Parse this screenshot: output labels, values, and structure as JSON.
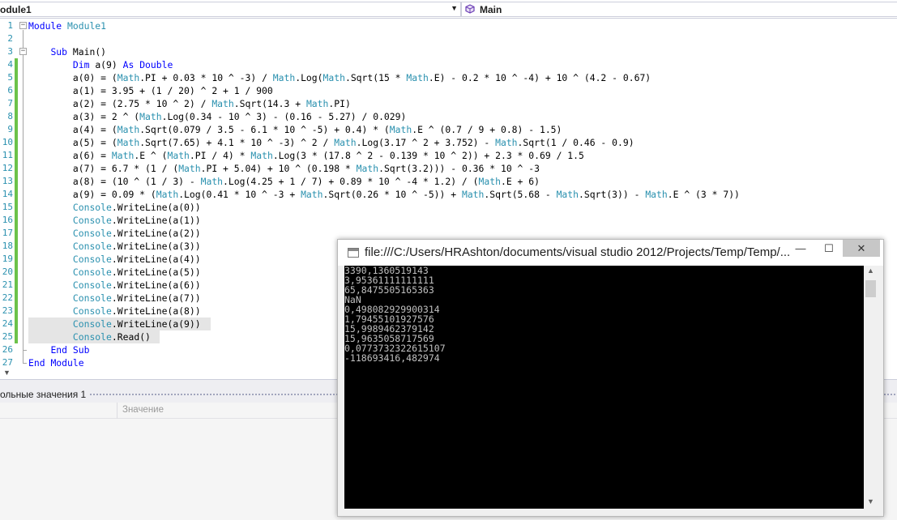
{
  "navbar": {
    "left_combo": "odule1",
    "right_combo": "Main"
  },
  "editor": {
    "line_numbers": [
      "1",
      "2",
      "3",
      "4",
      "5",
      "6",
      "7",
      "8",
      "9",
      "10",
      "11",
      "12",
      "13",
      "14",
      "15",
      "16",
      "17",
      "18",
      "19",
      "20",
      "21",
      "22",
      "23",
      "24",
      "25",
      "26",
      "27"
    ],
    "lines": [
      "Module Module1",
      "",
      "    Sub Main()",
      "        Dim a(9) As Double",
      "        a(0) = (Math.PI + 0.03 * 10 ^ -3) / Math.Log(Math.Sqrt(15 * Math.E) - 0.2 * 10 ^ -4) + 10 ^ (4.2 - 0.67)",
      "        a(1) = 3.95 + (1 / 20) ^ 2 + 1 / 900",
      "        a(2) = (2.75 * 10 ^ 2) / Math.Sqrt(14.3 + Math.PI)",
      "        a(3) = 2 ^ (Math.Log(0.34 - 10 ^ 3) - (0.16 - 5.27) / 0.029)",
      "        a(4) = (Math.Sqrt(0.079 / 3.5 - 6.1 * 10 ^ -5) + 0.4) * (Math.E ^ (0.7 / 9 + 0.8) - 1.5)",
      "        a(5) = (Math.Sqrt(7.65) + 4.1 * 10 ^ -3) ^ 2 / Math.Log(3.17 ^ 2 + 3.752) - Math.Sqrt(1 / 0.46 - 0.9)",
      "        a(6) = Math.E ^ (Math.PI / 4) * Math.Log(3 * (17.8 ^ 2 - 0.139 * 10 ^ 2)) + 2.3 * 0.69 / 1.5",
      "        a(7) = 6.7 * (1 / (Math.PI + 5.04) + 10 ^ (0.198 * Math.Sqrt(3.2))) - 0.36 * 10 ^ -3",
      "        a(8) = (10 ^ (1 / 3) - Math.Log(4.25 + 1 / 7) + 0.89 * 10 ^ -4 * 1.2) / (Math.E + 6)",
      "        a(9) = 0.09 * (Math.Log(0.41 * 10 ^ -3 + Math.Sqrt(0.26 * 10 ^ -5)) + Math.Sqrt(5.68 - Math.Sqrt(3)) - Math.E ^ (3 * 7))",
      "        Console.WriteLine(a(0))",
      "        Console.WriteLine(a(1))",
      "        Console.WriteLine(a(2))",
      "        Console.WriteLine(a(3))",
      "        Console.WriteLine(a(4))",
      "        Console.WriteLine(a(5))",
      "        Console.WriteLine(a(6))",
      "        Console.WriteLine(a(7))",
      "        Console.WriteLine(a(8))",
      "        Console.WriteLine(a(9))",
      "        Console.Read()",
      "    End Sub",
      "End Module"
    ],
    "changed_lines": [
      4,
      5,
      6,
      7,
      8,
      9,
      10,
      11,
      12,
      13,
      14,
      15,
      16,
      17,
      18,
      19,
      20,
      21,
      22,
      23,
      24,
      25
    ],
    "highlighted_lines": [
      24,
      25
    ],
    "keywords": [
      "Module",
      "Sub",
      "Dim",
      "As",
      "Double",
      "End"
    ],
    "types": [
      "Module1",
      "Math",
      "Console"
    ],
    "colors": {
      "keyword": "#0000ff",
      "type": "#2b91af",
      "line_number": "#2b91af",
      "change_bar": "#6cc24a"
    }
  },
  "locals": {
    "title": "ольные значения 1",
    "column_value": "Значение"
  },
  "console": {
    "title": "file:///C:/Users/HRAshton/documents/visual studio 2012/Projects/Temp/Temp/...",
    "output": [
      "3390,1360519143",
      "3,95361111111111",
      "65,8475505165363",
      "NaN",
      "0,498082929900314",
      "1,79455101927576",
      "15,9989462379142",
      "15,9635058717569",
      "0,0773732322615107",
      "-118693416,482974"
    ],
    "min_glyph": "—",
    "max_glyph": "☐",
    "close_glyph": "✕"
  }
}
